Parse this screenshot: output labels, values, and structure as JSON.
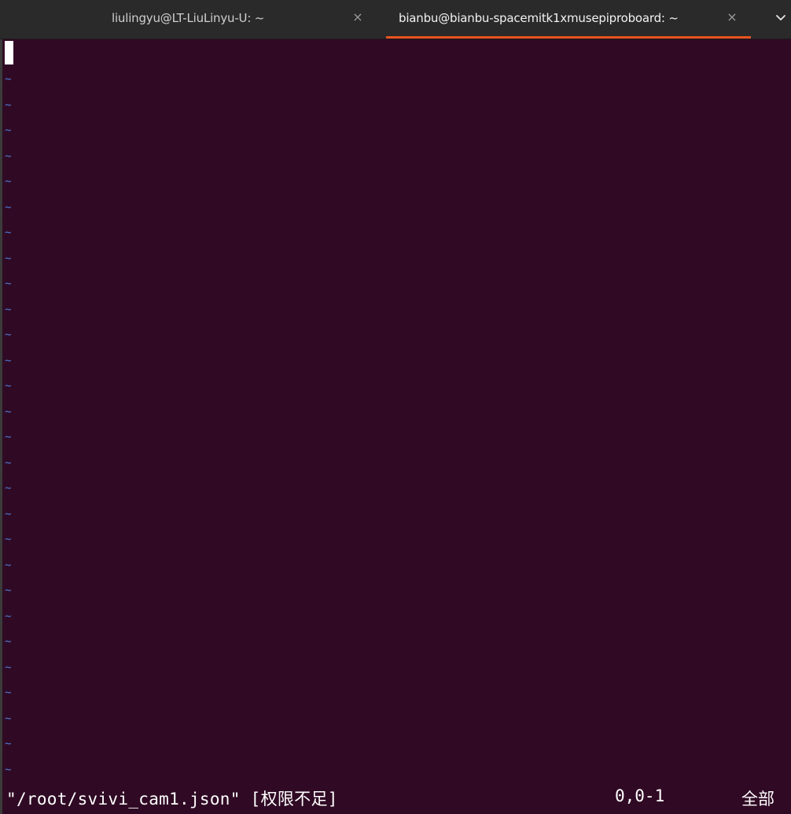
{
  "tabs": [
    {
      "title": "liulingyu@LT-LiuLinyu-U: ~",
      "close": "×",
      "active": false
    },
    {
      "title": "bianbu@bianbu-spacemitk1xmusepiproboard: ~",
      "close": "×",
      "active": true
    }
  ],
  "tab_menu_icon": "chevron-down-icon",
  "editor": {
    "empty_line_marker": "~",
    "status_message": "\"/root/svivi_cam1.json\" [权限不足]",
    "cursor_position": "0,0-1",
    "scroll_range": "全部"
  },
  "colors": {
    "terminal_bg": "#300a24",
    "tilde": "#4f7bd4",
    "active_tab_indicator": "#e95420",
    "tabbar_bg": "#2a2a2a"
  }
}
